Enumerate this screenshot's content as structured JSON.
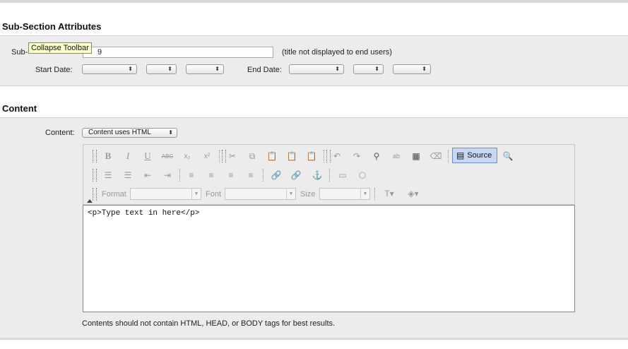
{
  "subsection": {
    "title": "Sub-Section Attributes",
    "name_label_prefix": "Sub-",
    "name_value": "9",
    "name_note": "(title not displayed to end users)",
    "start_label": "Start Date:",
    "end_label": "End Date:"
  },
  "tooltip": "Collapse Toolbar",
  "content": {
    "title": "Content",
    "field_label": "Content:",
    "type_value": "Content uses HTML",
    "editor_text": "<p>Type text in here</p>",
    "hint": "Contents should not contain HTML, HEAD, or BODY tags for best results."
  },
  "toolbar": {
    "bold": "B",
    "italic": "I",
    "underline": "U",
    "strike": "ABC",
    "subscript": "x₂",
    "superscript": "x²",
    "format_label": "Format",
    "font_label": "Font",
    "size_label": "Size",
    "source_label": "Source"
  }
}
